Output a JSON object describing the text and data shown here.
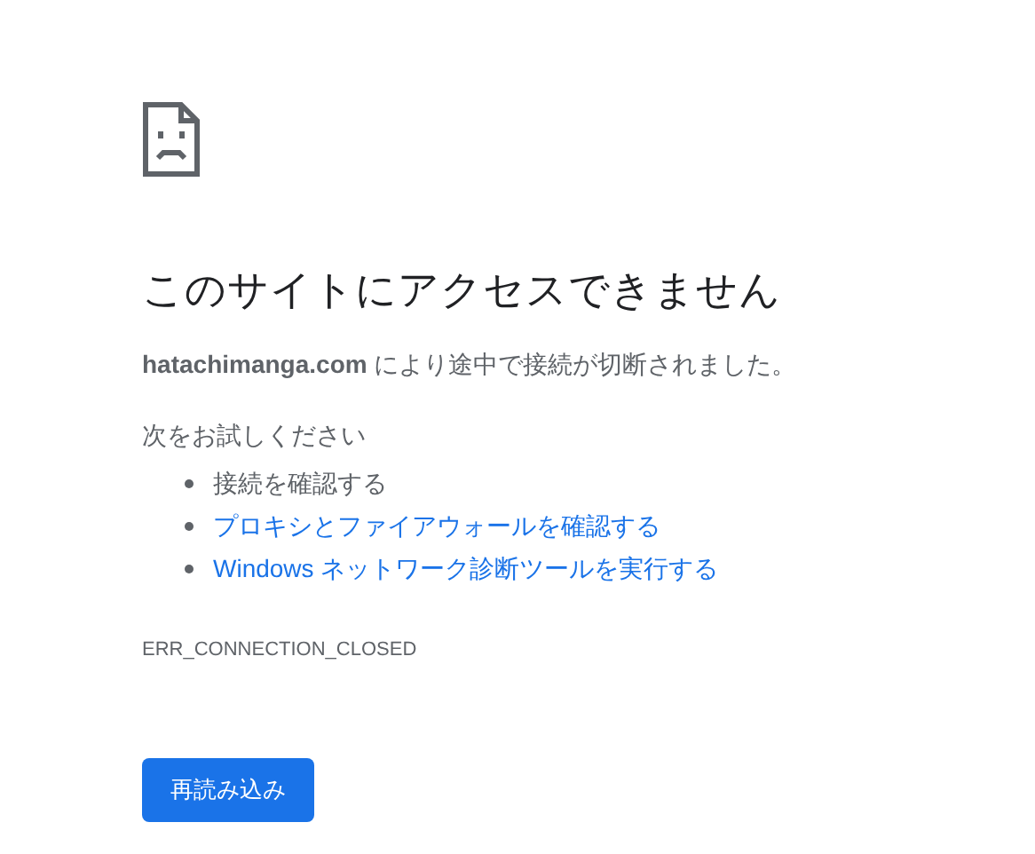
{
  "title": "このサイトにアクセスできません",
  "message": "**hatachimanga.com** により途中で接続が切断されました。",
  "suggestions_heading": "次をお試しください",
  "suggestions": [
    {
      "kind": "text",
      "label": "接続を確認する"
    },
    {
      "kind": "link",
      "label": "プロキシとファイアウォールを確認する"
    },
    {
      "kind": "link",
      "label": "Windows ネットワーク診断ツールを実行する"
    }
  ],
  "error_code": "ERR_CONNECTION_CLOSED",
  "reload_button": "再読み込み"
}
